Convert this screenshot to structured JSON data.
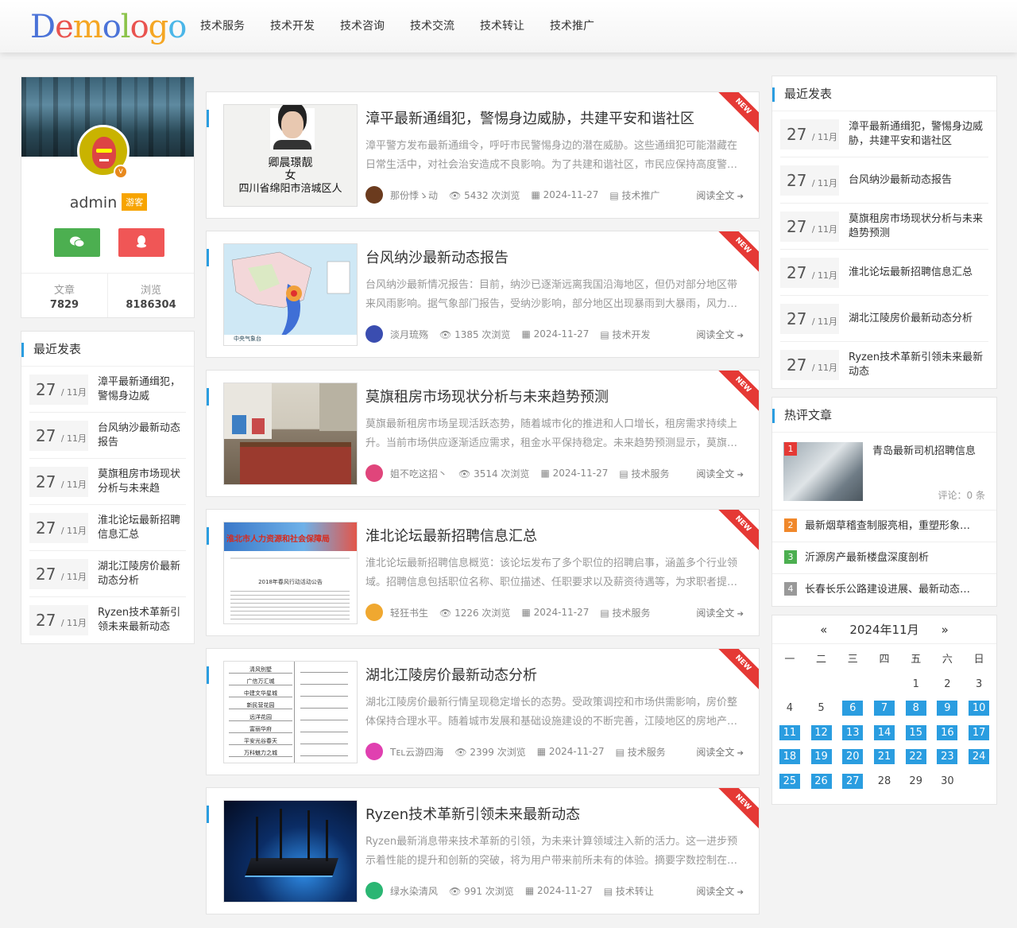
{
  "header": {
    "logo": "Demologo",
    "nav": [
      "技术服务",
      "技术开发",
      "技术咨询",
      "技术交流",
      "技术转让",
      "技术推广"
    ]
  },
  "profile": {
    "name": "admin",
    "tag": "游客",
    "badge": "v",
    "stats": [
      {
        "label": "文章",
        "value": "7829"
      },
      {
        "label": "浏览",
        "value": "8186304"
      }
    ]
  },
  "recent_title": "最近发表",
  "recent": [
    {
      "day": "27",
      "month": "/ 11月",
      "title": "漳平最新通缉犯，警惕身边威胁，共建平安和谐社区"
    },
    {
      "day": "27",
      "month": "/ 11月",
      "title": "台风纳沙最新动态报告"
    },
    {
      "day": "27",
      "month": "/ 11月",
      "title": "莫旗租房市场现状分析与未来趋势预测"
    },
    {
      "day": "27",
      "month": "/ 11月",
      "title": "淮北论坛最新招聘信息汇总"
    },
    {
      "day": "27",
      "month": "/ 11月",
      "title": "湖北江陵房价最新动态分析"
    },
    {
      "day": "27",
      "month": "/ 11月",
      "title": "Ryzen技术革新引领未来最新动态"
    }
  ],
  "recent_left": [
    "漳平最新通缉犯，警惕身边威",
    "台风纳沙最新动态报告",
    "莫旗租房市场现状分析与未来趋",
    "淮北论坛最新招聘信息汇总",
    "湖北江陵房价最新动态分析",
    "Ryzen技术革新引领未来最新动态"
  ],
  "post_common": {
    "ribbon": "NEW",
    "read": "阅读全文"
  },
  "posts": [
    {
      "title": "漳平最新通缉犯，警惕身边威胁，共建平安和谐社区",
      "desc": "漳平警方发布最新通缉令，呼吁市民警惕身边的潜在威胁。这些通缉犯可能潜藏在日常生活中，对社会治安造成不良影响。为了共建和谐社区，市民应保持高度警…",
      "author": "那份悸ゝ动",
      "views": "5432 次浏览",
      "date": "2024-11-27",
      "cat": "技术推广",
      "thumb_text": [
        "卿晨璟靓",
        "女",
        "四川省绵阳市涪城区人"
      ],
      "avatar_color": "#6b3b1e"
    },
    {
      "title": "台风纳沙最新动态报告",
      "desc": "台风纳沙最新情况报告：目前，纳沙已逐渐远离我国沿海地区，但仍对部分地区带来风雨影响。据气象部门报告，受纳沙影响，部分地区出现暴雨到大暴雨，风力…",
      "author": "淡月琉殇",
      "views": "1385 次浏览",
      "date": "2024-11-27",
      "cat": "技术开发",
      "thumb_text": [
        "中央气象台"
      ],
      "avatar_color": "#3a4db0"
    },
    {
      "title": "莫旗租房市场现状分析与未来趋势预测",
      "desc": "莫旗最新租房市场呈现活跃态势，随着城市化的推进和人口增长，租房需求持续上升。当前市场供应逐渐适应需求，租金水平保持稳定。未来趋势预测显示，莫旗…",
      "author": "姐不吃这招丶",
      "views": "3514 次浏览",
      "date": "2024-11-27",
      "cat": "技术服务",
      "thumb_text": [],
      "avatar_color": "#e0457b"
    },
    {
      "title": "淮北论坛最新招聘信息汇总",
      "desc": "淮北论坛最新招聘信息概览：该论坛发布了多个职位的招聘启事，涵盖多个行业领域。招聘信息包括职位名称、职位描述、任职要求以及薪资待遇等，为求职者提…",
      "author": "轻狂书生",
      "views": "1226 次浏览",
      "date": "2024-11-27",
      "cat": "技术服务",
      "thumb_text": [
        "淮北市人力资源和社会保障局",
        "2018年春风行动活动公告"
      ],
      "avatar_color": "#f0a830"
    },
    {
      "title": "湖北江陵房价最新动态分析",
      "desc": "湖北江陵房价最新行情呈现稳定增长的态势。受政策调控和市场供需影响，房价整体保持合理水平。随着城市发展和基础设施建设的不断完善，江陵地区的房地产…",
      "author": "Tᴇʟ云游四海",
      "views": "2399 次浏览",
      "date": "2024-11-27",
      "cat": "技术服务",
      "thumb_text": [
        "清风别墅",
        "广信万汇城",
        "中建文华星城",
        "新民营花园",
        "远洋花园",
        "富丽华府",
        "平安光谷春天",
        "万科魅力之城"
      ],
      "avatar_color": "#e040b0"
    },
    {
      "title": "Ryzen技术革新引领未来最新动态",
      "desc": "Ryzen最新消息带来技术革新的引领，为未来计算领域注入新的活力。这一进步预示着性能的提升和创新的突破，将为用户带来前所未有的体验。摘要字数控制在…",
      "author": "绿水染清风",
      "views": "991 次浏览",
      "date": "2024-11-27",
      "cat": "技术转让",
      "thumb_text": [],
      "avatar_color": "#2bb673"
    }
  ],
  "hot_title": "热评文章",
  "hot_top": {
    "num": "1",
    "title": "青岛最新司机招聘信息",
    "comment": "评论：0 条"
  },
  "hot": [
    {
      "num": "2",
      "color": "#f0882b",
      "title": "最新烟草稽查制服亮相，重塑形象…"
    },
    {
      "num": "3",
      "color": "#4caf50",
      "title": "沂源房产最新楼盘深度剖析"
    },
    {
      "num": "4",
      "color": "#999999",
      "title": "长春长乐公路建设进展、最新动态…"
    }
  ],
  "calendar": {
    "prev": "«",
    "title": "2024年11月",
    "next": "»",
    "weekdays": [
      "一",
      "二",
      "三",
      "四",
      "五",
      "六",
      "日"
    ],
    "leading_blanks": 4,
    "days_in_month": 30,
    "highlight_from": 6,
    "highlight_to": 27
  },
  "colors": {
    "accent": "#2a9de0",
    "ribbon": "#e53935",
    "wechat": "#4caf50",
    "qq": "#f05656",
    "tag": "#f7a400"
  }
}
